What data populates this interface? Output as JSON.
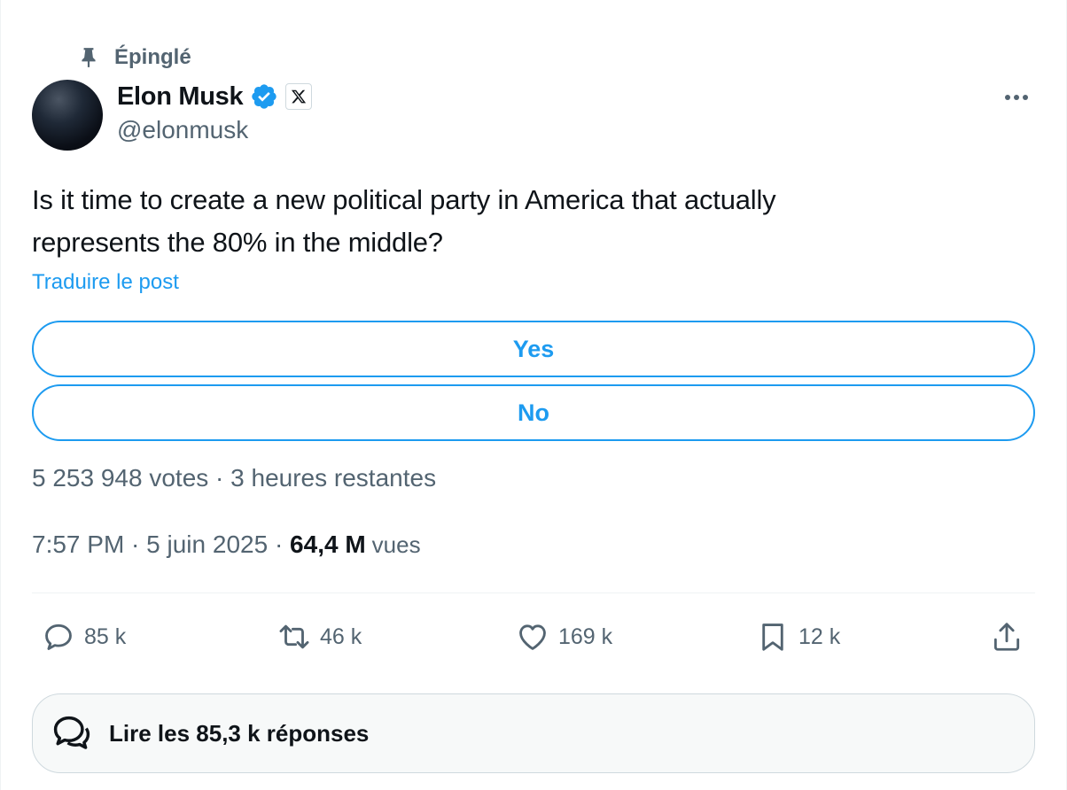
{
  "pinned": {
    "label": "Épinglé"
  },
  "author": {
    "display_name": "Elon Musk",
    "handle": "@elonmusk",
    "verified_color": "#1d9bf0"
  },
  "tweet": {
    "text_line1": "Is it time to create a new political party in America that actually",
    "text_line2": "represents the 80% in the middle?",
    "translate_label": "Traduire le post"
  },
  "poll": {
    "options": [
      {
        "label": "Yes"
      },
      {
        "label": "No"
      }
    ],
    "meta": "5 253 948 votes · 3 heures restantes"
  },
  "timestamp": {
    "datetime": "7:57 PM · 5 juin 2025 · ",
    "views_count": "64,4 M",
    "views_label": "vues"
  },
  "actions": {
    "replies": "85 k",
    "reposts": "46 k",
    "likes": "169 k",
    "bookmarks": "12 k"
  },
  "read_replies": {
    "label": "Lire les 85,3 k réponses"
  },
  "icons": {
    "pin": "pin-icon",
    "verified": "verified-badge-icon",
    "affiliate": "x-logo-icon",
    "more": "more-icon",
    "reply": "reply-icon",
    "repost": "repost-icon",
    "like": "heart-icon",
    "bookmark": "bookmark-icon",
    "share": "share-icon",
    "conversation": "conversation-icon"
  },
  "colors": {
    "accent": "#1d9bf0",
    "secondary_text": "#536471",
    "primary_text": "#0f1419"
  }
}
